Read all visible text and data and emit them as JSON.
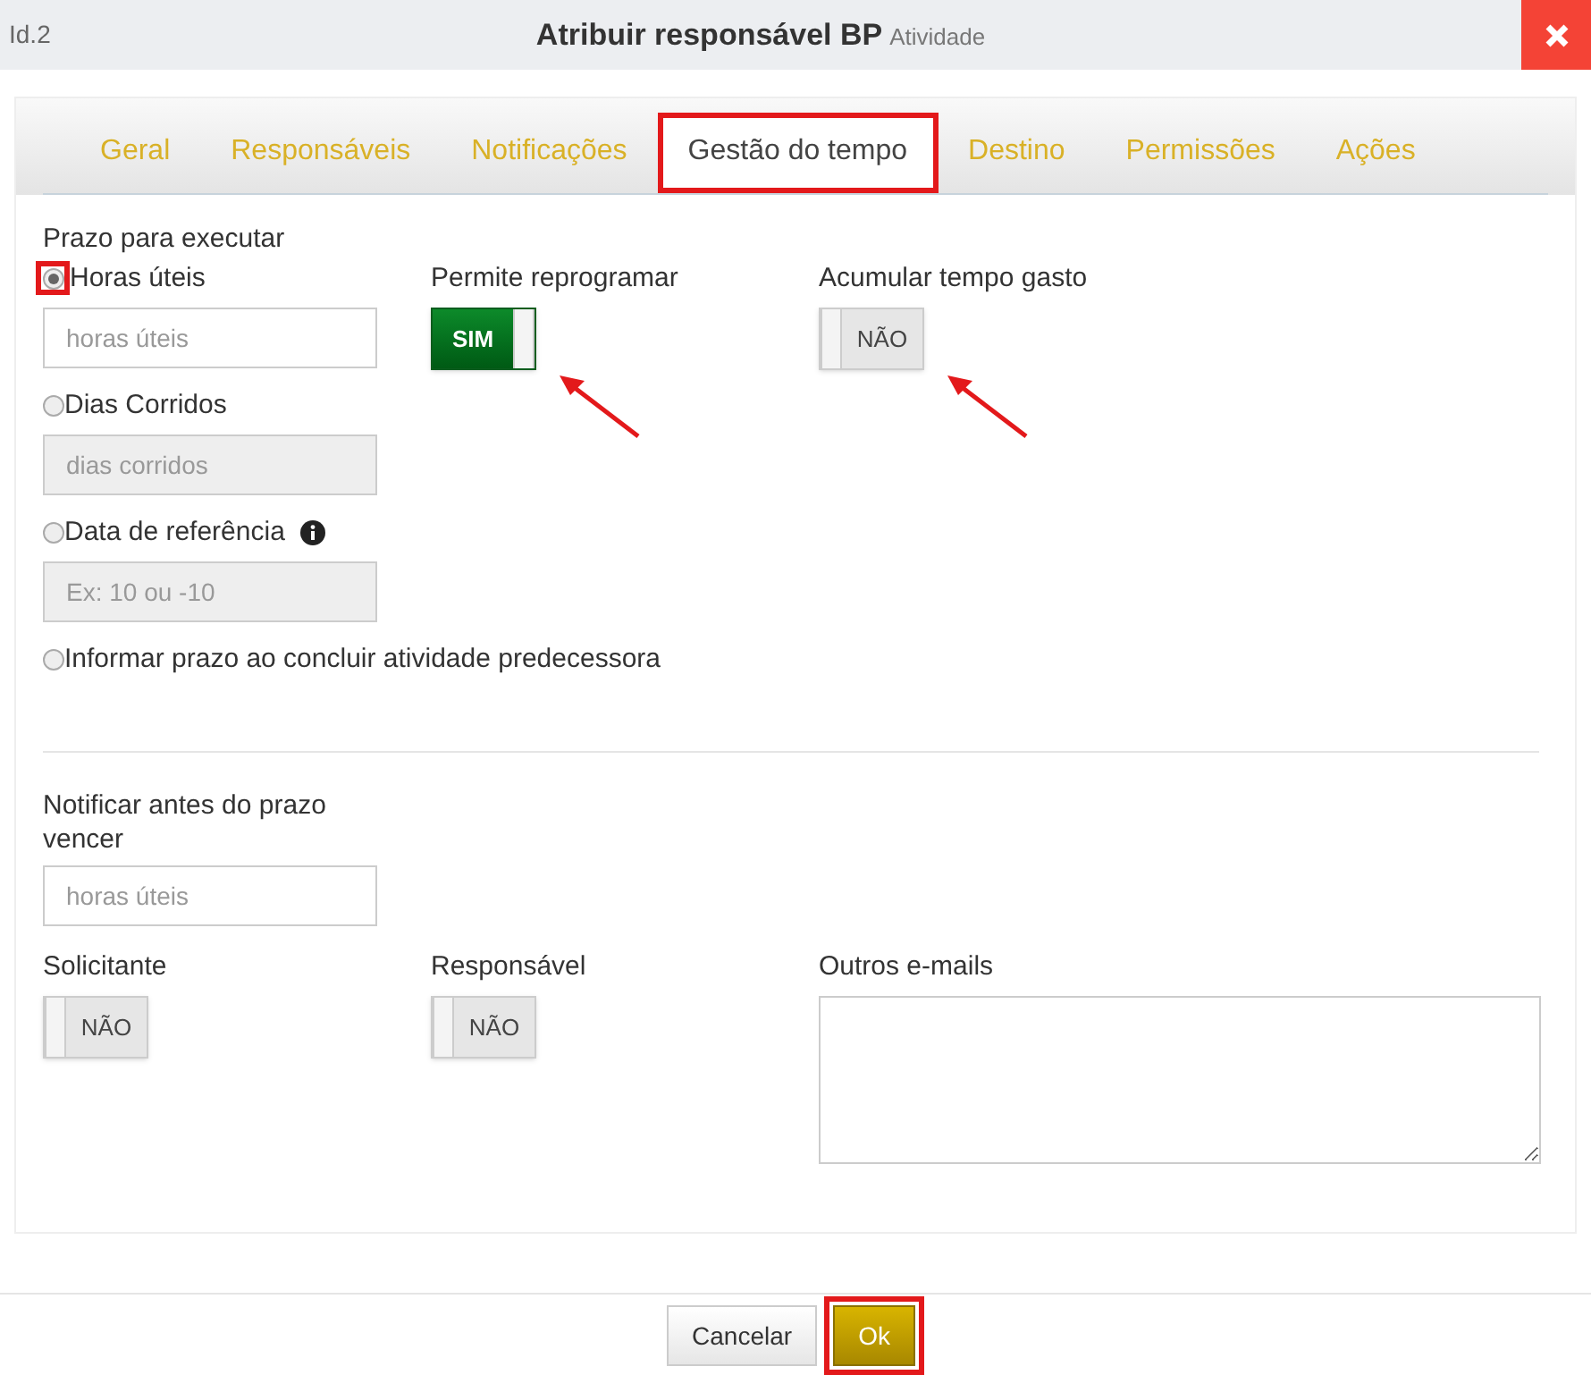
{
  "header": {
    "id": "Id.2",
    "title": "Atribuir responsável BP",
    "subtitle": "Atividade"
  },
  "tabs": [
    {
      "label": "Geral",
      "selected": false,
      "annotated": false
    },
    {
      "label": "Responsáveis",
      "selected": false,
      "annotated": false
    },
    {
      "label": "Notificações",
      "selected": false,
      "annotated": false
    },
    {
      "label": "Gestão do tempo",
      "selected": true,
      "annotated": true
    },
    {
      "label": "Destino",
      "selected": false,
      "annotated": false
    },
    {
      "label": "Permissões",
      "selected": false,
      "annotated": false
    },
    {
      "label": "Ações",
      "selected": false,
      "annotated": false
    }
  ],
  "deadline": {
    "label": "Prazo para executar",
    "options": [
      {
        "label": "Horas úteis",
        "selected": true,
        "annotated": true,
        "info": false,
        "field": {
          "placeholder": "horas úteis",
          "disabled": false
        }
      },
      {
        "label": "Dias Corridos",
        "selected": false,
        "annotated": false,
        "info": false,
        "field": {
          "placeholder": "dias corridos",
          "disabled": true
        }
      },
      {
        "label": "Data de referência",
        "selected": false,
        "annotated": false,
        "info": true,
        "field": {
          "placeholder": "Ex: 10 ou -10",
          "disabled": true
        }
      },
      {
        "label": "Informar prazo ao concluir atividade predecessora",
        "selected": false,
        "annotated": false,
        "info": false
      }
    ]
  },
  "time_toggles": [
    {
      "label": "Permite reprogramar",
      "on": true,
      "text": "SIM",
      "annotated": true
    },
    {
      "label": "Acumular tempo gasto",
      "on": false,
      "text": "NÃO",
      "annotated": true
    }
  ],
  "notify": {
    "label": "Notificar antes do prazo vencer",
    "placeholder": "horas úteis"
  },
  "recipients": [
    {
      "label": "Solicitante",
      "on": false,
      "text": "NÃO"
    },
    {
      "label": "Responsável",
      "on": false,
      "text": "NÃO"
    }
  ],
  "other_emails": {
    "label": "Outros e-mails"
  },
  "buttons": [
    {
      "label": "Cancelar",
      "kind": "secondary",
      "annotated": false
    },
    {
      "label": "Ok",
      "kind": "primary",
      "annotated": true
    }
  ]
}
